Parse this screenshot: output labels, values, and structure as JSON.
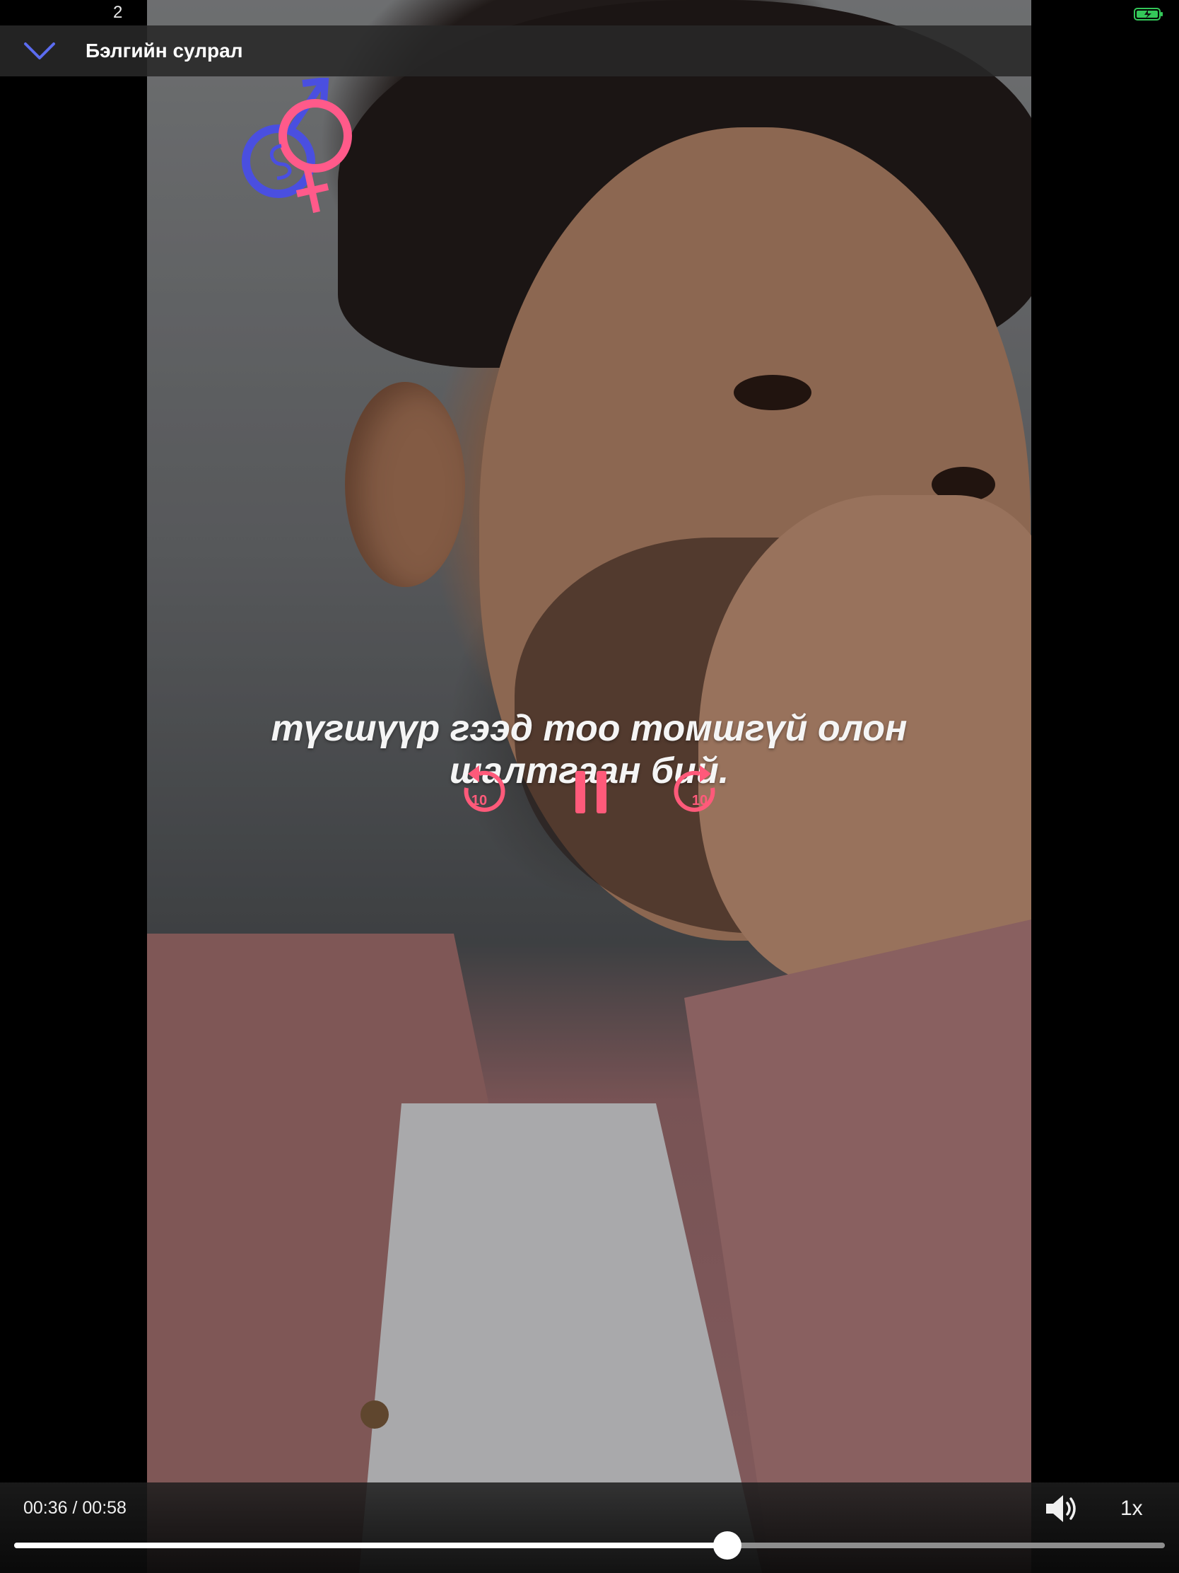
{
  "status_bar": {
    "time": "2",
    "battery_icon": "battery-charging-icon",
    "battery_color": "#34c759"
  },
  "header": {
    "collapse_icon": "chevron-down-icon",
    "title": "Бэлгийн сулрал",
    "accent_color": "#5b6cf0"
  },
  "video": {
    "logo_icon": "gender-symbols-logo",
    "caption_line1": "түгшүүр гээд тоо томшгүй олон",
    "caption_line2": "шалтгаан бий."
  },
  "controls": {
    "rewind_icon": "rewind-10-icon",
    "rewind_label": "10",
    "pause_icon": "pause-icon",
    "forward_icon": "forward-10-icon",
    "forward_label": "10",
    "color": "#ff5a7a"
  },
  "bottom_bar": {
    "time_readout": "00:36 / 00:58",
    "volume_icon": "speaker-volume-icon",
    "speed_label": "1x",
    "progress_fraction": 0.62
  }
}
